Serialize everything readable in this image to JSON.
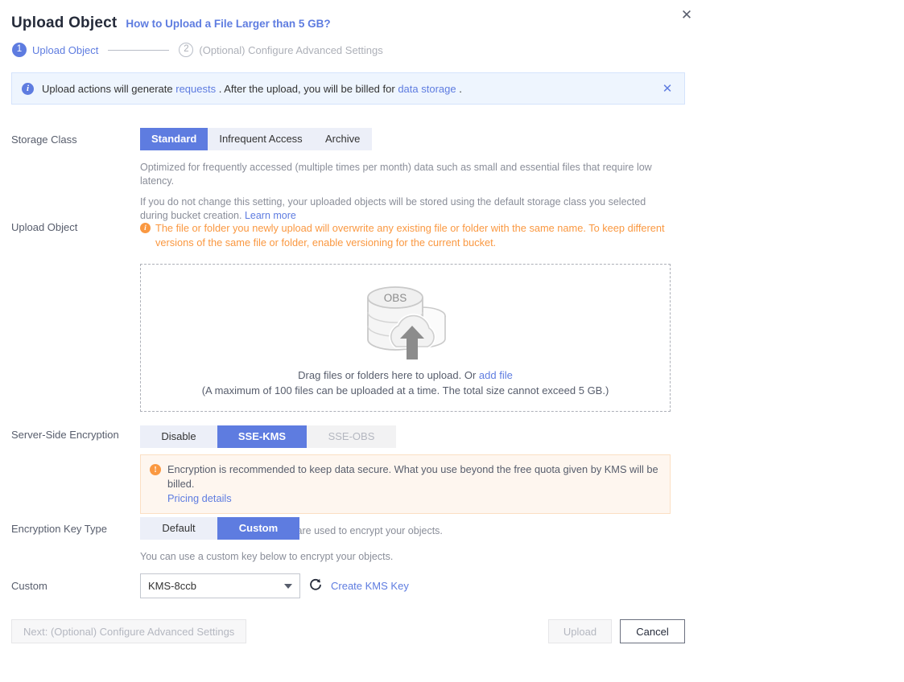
{
  "window": {
    "close_label": "✕"
  },
  "header": {
    "title": "Upload Object",
    "help_link": "How to Upload a File Larger than 5 GB?"
  },
  "steps": [
    {
      "number": "1",
      "label": "Upload Object",
      "state": "active"
    },
    {
      "number": "2",
      "label": "(Optional) Configure Advanced Settings",
      "state": "todo"
    }
  ],
  "info_banner": {
    "icon": "info-icon",
    "text_before": "Upload actions will generate",
    "link1": "requests",
    "text_middle": ". After the upload, you will be billed for",
    "link2": "data storage",
    "text_after": ".",
    "close_label": "✕"
  },
  "storage_class": {
    "label": "Storage Class",
    "options": [
      {
        "label": "Standard",
        "state": "selected"
      },
      {
        "label": "Infrequent Access",
        "state": "normal"
      },
      {
        "label": "Archive",
        "state": "normal"
      }
    ],
    "hint1": "Optimized for frequently accessed (multiple times per month) data such as small and essential files that require low latency.",
    "hint2": "If you do not change this setting, your uploaded objects will be stored using the default storage class you selected during bucket creation.",
    "hint2_link": "Learn more"
  },
  "upload_object": {
    "label": "Upload Object",
    "warning": "The file or folder you newly upload will overwrite any existing file or folder with the same name. To keep different versions of the same file or folder, enable versioning for the current bucket.",
    "dropzone": {
      "icon_label": "OBS",
      "line1_before": "Drag files or folders here to upload. Or",
      "line1_link": "add file",
      "line2": "(A maximum of 100 files can be uploaded at a time. The total size cannot exceed 5 GB.)"
    }
  },
  "server_side_encryption": {
    "label": "Server-Side Encryption",
    "options": [
      {
        "label": "Disable",
        "state": "normal"
      },
      {
        "label": "SSE-KMS",
        "state": "selected"
      },
      {
        "label": "SSE-OBS",
        "state": "disabled"
      }
    ],
    "alert_text": "Encryption is recommended to keep data secure. What you use beyond the free quota given by KMS will be billed.",
    "alert_link": "Pricing details",
    "hint": "Encryption keys managed by KMS are used to encrypt your objects."
  },
  "encryption_key_type": {
    "label": "Encryption Key Type",
    "options": [
      {
        "label": "Default",
        "state": "normal"
      },
      {
        "label": "Custom",
        "state": "selected"
      }
    ],
    "hint": "You can use a custom key below to encrypt your objects."
  },
  "custom_key": {
    "label": "Custom",
    "selected_value": "KMS-8ccb",
    "refresh_icon": "refresh-icon",
    "create_link": "Create KMS Key"
  },
  "footer": {
    "next_label": "Next: (Optional) Configure Advanced Settings",
    "upload_label": "Upload",
    "cancel_label": "Cancel"
  },
  "colors": {
    "accent": "#5e7ce0",
    "warning": "#fa9841",
    "segment_bg": "#eceff8",
    "info_bg": "#eef5fe",
    "alert_bg": "#fef6ef"
  }
}
